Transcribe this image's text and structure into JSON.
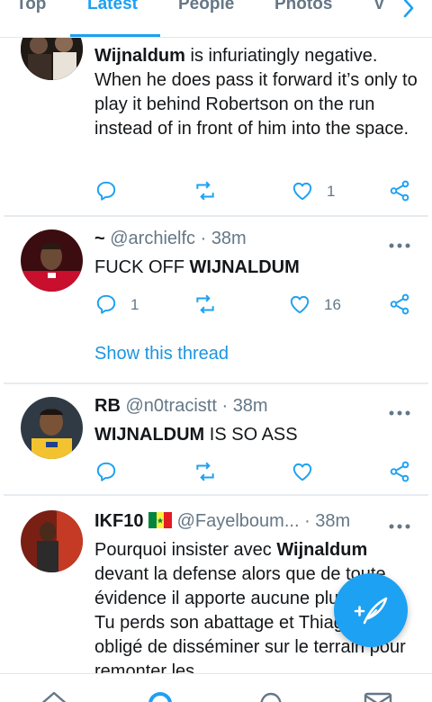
{
  "tabs": [
    {
      "label": "Top",
      "active": false
    },
    {
      "label": "Latest",
      "active": true
    },
    {
      "label": "People",
      "active": false
    },
    {
      "label": "Photos",
      "active": false
    },
    {
      "label": "V",
      "active": false
    }
  ],
  "accent_color": "#1da1f2",
  "tweets": [
    {
      "avatar_icon": "user-photo",
      "body_parts": [
        {
          "bold": true,
          "text": "Wijnaldum"
        },
        {
          "bold": false,
          "text": " is infuriatingly negative. When he does pass it forward it’s only to play it behind Robertson on the run instead of in front of him into the space."
        }
      ],
      "reply_count": "",
      "retweet_count": "",
      "like_count": "1"
    },
    {
      "name": "~",
      "handle": "@archielfc",
      "time": "38m",
      "avatar_icon": "user-photo",
      "body_parts": [
        {
          "bold": false,
          "text": "FUCK OFF "
        },
        {
          "bold": true,
          "text": "WIJNALDUM"
        }
      ],
      "reply_count": "1",
      "retweet_count": "",
      "like_count": "16",
      "thread_link": "Show this thread"
    },
    {
      "name": "RB",
      "handle": "@n0tracistt",
      "time": "38m",
      "avatar_icon": "user-photo",
      "body_parts": [
        {
          "bold": true,
          "text": "WIJNALDUM"
        },
        {
          "bold": false,
          "text": " IS SO ASS"
        }
      ],
      "reply_count": "",
      "retweet_count": "",
      "like_count": ""
    },
    {
      "name": "IKF10",
      "name_emoji": "senegal-flag-icon",
      "handle": "@Fayelboum...",
      "time": "38m",
      "avatar_icon": "user-photo",
      "body_parts": [
        {
          "bold": false,
          "text": "Pourquoi insister avec "
        },
        {
          "bold": true,
          "text": "Wijnaldum"
        },
        {
          "bold": false,
          "text": " devant la defense alors que de toute évidence il apporte aucune plus value. Tu perds son abattage et Thiago est obligé de disséminer sur le terrain pour remonter les"
        }
      ]
    }
  ],
  "icons": {
    "reply": "reply-icon",
    "retweet": "retweet-icon",
    "like": "like-icon",
    "share": "share-icon",
    "more": "more-icon",
    "compose": "compose-tweet-icon",
    "nav": [
      "home-icon",
      "search-icon",
      "notifications-icon",
      "messages-icon"
    ]
  }
}
